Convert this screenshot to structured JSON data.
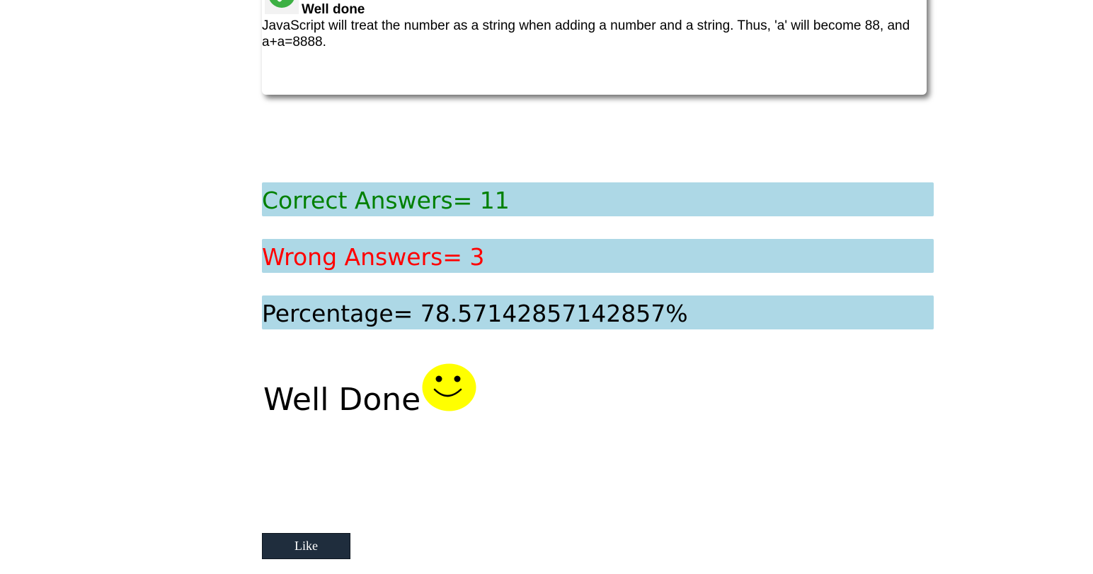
{
  "feedback": {
    "icon": "check-circle-icon",
    "title": "Well done",
    "explanation": "JavaScript will treat the number as a string when adding a number and a string. Thus, 'a' will become 88, and a+a=8888."
  },
  "results": {
    "correct_text": "Correct Answers= 11",
    "wrong_text": "Wrong Answers= 3",
    "percentage_text": "Percentage= 78.57142857142857%"
  },
  "message": {
    "text": "Well Done",
    "icon": "smiley-face-icon"
  },
  "like_button": {
    "label": "Like"
  },
  "colors": {
    "bar_background": "#add8e6",
    "correct": "#008000",
    "wrong": "#ff0000",
    "check_green": "#3cb043",
    "smiley_yellow": "#ffff00",
    "button_background": "#1f2d3d"
  }
}
